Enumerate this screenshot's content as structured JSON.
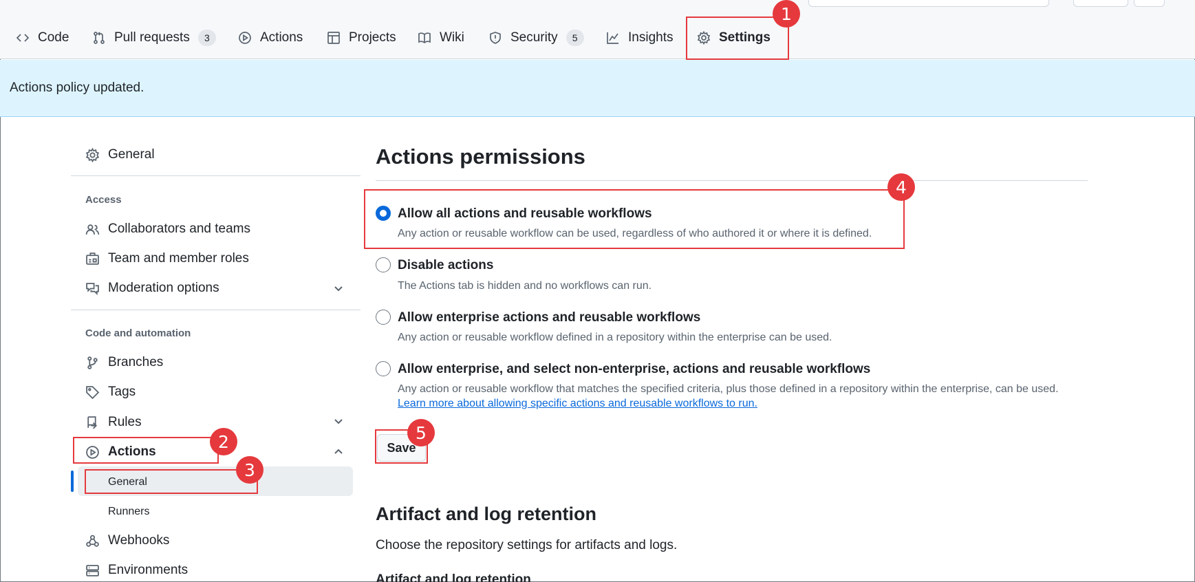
{
  "repo_nav": {
    "tabs": [
      {
        "label": "Code",
        "icon": "code-icon"
      },
      {
        "label": "Pull requests",
        "icon": "git-pull-request-icon",
        "count": "3"
      },
      {
        "label": "Actions",
        "icon": "play-icon"
      },
      {
        "label": "Projects",
        "icon": "table-icon"
      },
      {
        "label": "Wiki",
        "icon": "book-icon"
      },
      {
        "label": "Security",
        "icon": "shield-icon",
        "count": "5"
      },
      {
        "label": "Insights",
        "icon": "graph-icon"
      },
      {
        "label": "Settings",
        "icon": "gear-icon",
        "active": true
      }
    ]
  },
  "flash": {
    "message": "Actions policy updated."
  },
  "sidebar": {
    "general": "General",
    "access_heading": "Access",
    "access_items": [
      "Collaborators and teams",
      "Team and member roles",
      "Moderation options"
    ],
    "code_heading": "Code and automation",
    "code_items": [
      "Branches",
      "Tags",
      "Rules",
      "Actions"
    ],
    "actions_sub": [
      "General",
      "Runners"
    ],
    "more_items": [
      "Webhooks",
      "Environments"
    ]
  },
  "main": {
    "title": "Actions permissions",
    "options": [
      {
        "label": "Allow all actions and reusable workflows",
        "desc": "Any action or reusable workflow can be used, regardless of who authored it or where it is defined.",
        "checked": true
      },
      {
        "label": "Disable actions",
        "desc": "The Actions tab is hidden and no workflows can run.",
        "checked": false
      },
      {
        "label": "Allow enterprise actions and reusable workflows",
        "desc": "Any action or reusable workflow defined in a repository within the enterprise can be used.",
        "checked": false
      },
      {
        "label": "Allow enterprise, and select non-enterprise, actions and reusable workflows",
        "desc": "Any action or reusable workflow that matches the specified criteria, plus those defined in a repository within the enterprise, can be used.",
        "checked": false
      }
    ],
    "learn_more": "Learn more about allowing specific actions and reusable workflows to run.",
    "save_label": "Save",
    "section2_title": "Artifact and log retention",
    "section2_desc": "Choose the repository settings for artifacts and logs.",
    "section2_sub": "Artifact and log retention"
  },
  "annotations": [
    "1",
    "2",
    "3",
    "4",
    "5"
  ],
  "colors": {
    "accent": "#0969da",
    "annotation": "#e5393d",
    "flash_bg": "#ddf4ff",
    "tab_underline": "#fd8c73"
  }
}
